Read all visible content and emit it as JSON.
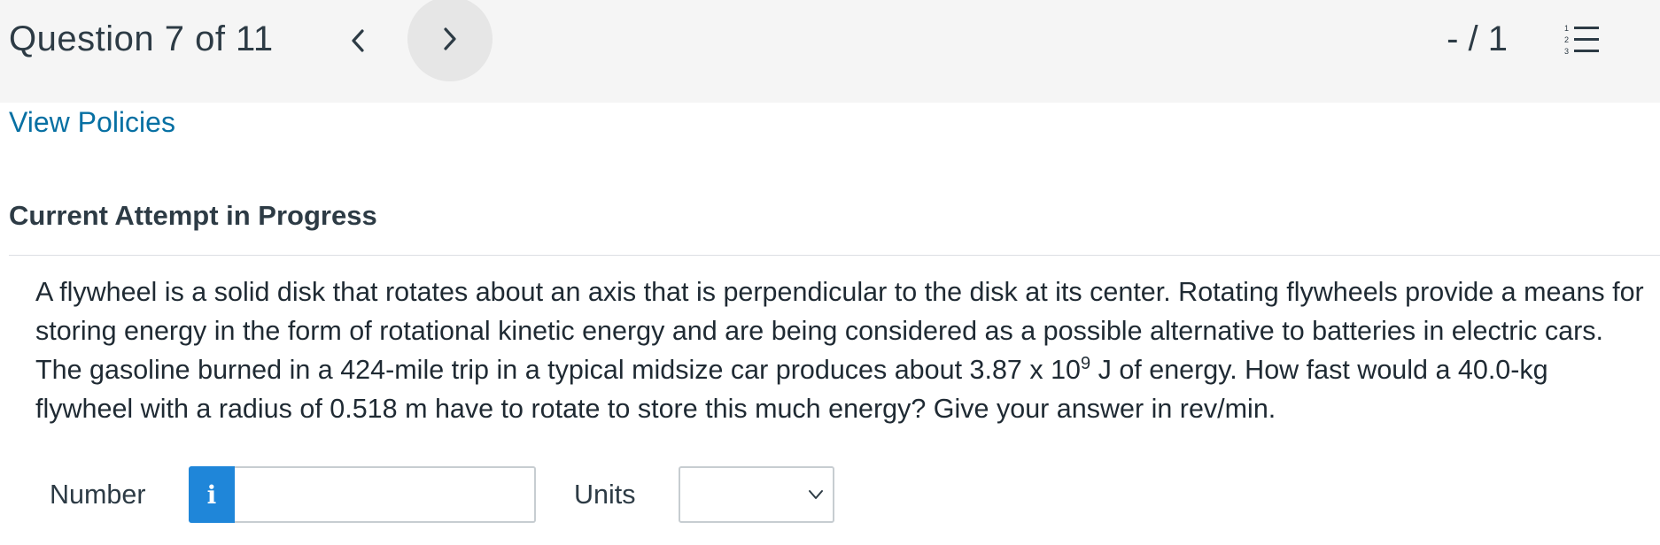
{
  "header": {
    "title": "Question 7 of 11",
    "score": "- / 1",
    "prev_icon": "chevron-left-icon",
    "next_icon": "chevron-right-icon",
    "list_icon": "numbered-list-icon"
  },
  "links": {
    "view_policies": "View Policies"
  },
  "attempt_heading": "Current Attempt in Progress",
  "question": {
    "text_before": "A flywheel is a solid disk that rotates about an axis that is perpendicular to the disk at its center. Rotating flywheels provide a means for storing energy in the form of rotational kinetic energy and are being considered as a possible alternative to batteries in electric cars. The gasoline burned in a 424-mile trip in a typical midsize car produces about 3.87 x 10",
    "exponent": "9",
    "text_after": " J of energy. How fast would a 40.0-kg flywheel with a radius of 0.518 m have to rotate to store this much energy? Give your answer in rev/min."
  },
  "answer": {
    "number_label": "Number",
    "info_label": "i",
    "number_value": "",
    "units_label": "Units",
    "units_selected": ""
  },
  "colors": {
    "link": "#0770a3",
    "info_button": "#1f86d9",
    "header_bg": "#f5f5f5",
    "next_button_bg": "#e6e6e6"
  }
}
